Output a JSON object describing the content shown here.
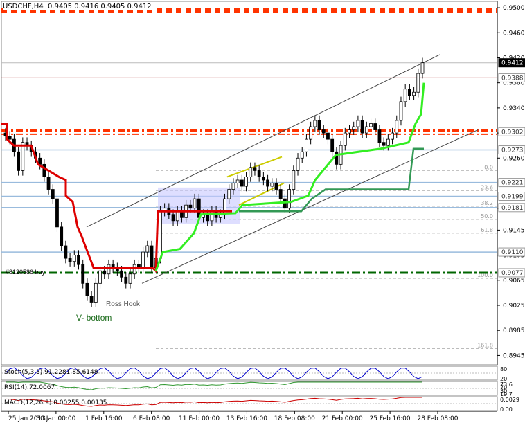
{
  "header": {
    "symbol": "USDCHF,H4",
    "ohlc": "0.9405 0.9416 0.9405 0.9412"
  },
  "chart_data": {
    "type": "candlestick",
    "symbol": "USDCHF",
    "timeframe": "H4",
    "ylim": [
      0.893,
      0.951
    ],
    "y_ticks": [
      "0.9500",
      "0.9460",
      "0.9420",
      "0.9380",
      "0.9340",
      "0.9300",
      "0.9260",
      "0.9220",
      "0.9180",
      "0.9145",
      "0.9105",
      "0.9065",
      "0.9025",
      "0.8985",
      "0.8945"
    ],
    "x_ticks": [
      "25 Jan 2013",
      "30 Jan 00:00",
      "1 Feb 16:00",
      "6 Feb 08:00",
      "11 Feb 00:00",
      "13 Feb 16:00",
      "18 Feb 08:00",
      "21 Feb 00:00",
      "25 Feb 16:00",
      "28 Feb 08:00"
    ],
    "price_tags": [
      {
        "label": "0.9412",
        "value": 0.9412,
        "style": "current"
      },
      {
        "label": "0.9388",
        "value": 0.9388,
        "style": "level"
      },
      {
        "label": "0.9302",
        "value": 0.9302,
        "style": "level"
      },
      {
        "label": "0.9273",
        "value": 0.9273,
        "style": "level"
      },
      {
        "label": "0.9221",
        "value": 0.9221,
        "style": "level"
      },
      {
        "label": "0.9199",
        "value": 0.9199,
        "style": "level"
      },
      {
        "label": "0.9181",
        "value": 0.9181,
        "style": "level"
      },
      {
        "label": "0.9110",
        "value": 0.911,
        "style": "level"
      },
      {
        "label": "0.9077",
        "value": 0.9077,
        "style": "level"
      }
    ],
    "fib_labels": [
      {
        "label": "0.0",
        "value": 0.924
      },
      {
        "label": "23.6",
        "value": 0.9208
      },
      {
        "label": "38.2",
        "value": 0.9183
      },
      {
        "label": "50.0",
        "value": 0.9162
      },
      {
        "label": "61.8",
        "value": 0.914
      },
      {
        "label": "100.0",
        "value": 0.9068
      },
      {
        "label": "161.8",
        "value": 0.8956
      }
    ],
    "annotations": [
      {
        "text": "#8120586 buy",
        "value": 0.908
      },
      {
        "text": "Ross Hook",
        "value": 0.904
      },
      {
        "text": "V- bottom",
        "value": 0.9017
      }
    ],
    "colors": {
      "candle": "#000000",
      "red_line": "#dd0000",
      "green_bright": "#33ee22",
      "green_dark": "#339955",
      "channel": "#444444",
      "resistance_dash": "#ff3300",
      "support_dash": "#006600",
      "blue_level": "#99bbdd",
      "rect_fill": "#c8c8ff"
    },
    "close_series": [
      0.9295,
      0.929,
      0.927,
      0.924,
      0.9285,
      0.928,
      0.927,
      0.926,
      0.925,
      0.923,
      0.921,
      0.9195,
      0.915,
      0.912,
      0.91,
      0.9095,
      0.9105,
      0.909,
      0.906,
      0.904,
      0.903,
      0.906,
      0.908,
      0.9075,
      0.909,
      0.9085,
      0.908,
      0.907,
      0.906,
      0.9075,
      0.909,
      0.9085,
      0.911,
      0.912,
      0.9085,
      0.91,
      0.9175,
      0.918,
      0.917,
      0.916,
      0.9175,
      0.9165,
      0.9185,
      0.918,
      0.9195,
      0.9165,
      0.917,
      0.916,
      0.9175,
      0.9165,
      0.917,
      0.9195,
      0.921,
      0.922,
      0.9225,
      0.9215,
      0.923,
      0.9245,
      0.924,
      0.923,
      0.9225,
      0.9215,
      0.922,
      0.921,
      0.9195,
      0.918,
      0.921,
      0.924,
      0.926,
      0.927,
      0.929,
      0.931,
      0.932,
      0.9305,
      0.93,
      0.929,
      0.927,
      0.925,
      0.928,
      0.93,
      0.9305,
      0.931,
      0.932,
      0.93,
      0.931,
      0.9315,
      0.9305,
      0.9285,
      0.928,
      0.929,
      0.93,
      0.932,
      0.935,
      0.937,
      0.936,
      0.9365,
      0.9395,
      0.9412
    ],
    "stoch": {
      "label": "Stoch(5,3,3) 91.2281 85.6148",
      "levels": [
        "80",
        "20"
      ]
    },
    "rsi": {
      "label": "RSI(14) 72.0067",
      "levels": [
        "73.6",
        "70",
        "30",
        "19.7"
      ]
    },
    "macd": {
      "label": "MACD(12,26,9) 0.00255 0.00135",
      "levels": [
        "0.0029",
        "0.00"
      ]
    }
  }
}
